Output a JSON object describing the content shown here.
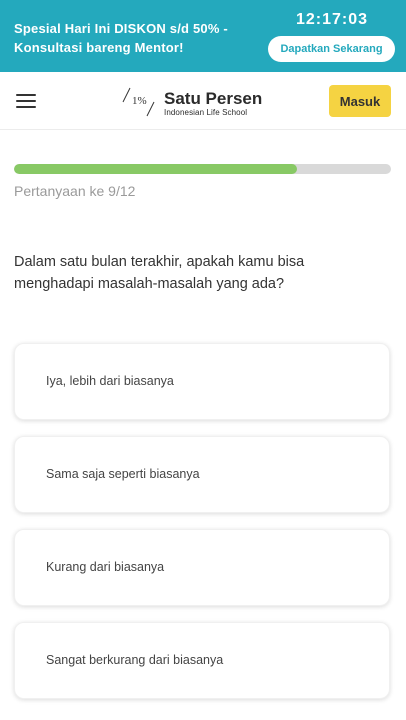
{
  "promo": {
    "text": "Spesial Hari Ini DISKON s/d 50% - Konsultasi bareng Mentor!",
    "timer": "12:17:03",
    "cta_label": "Dapatkan Sekarang"
  },
  "nav": {
    "menu_icon": "hamburger-menu-icon",
    "logo_mark": "1%",
    "logo_name": "Satu Persen",
    "logo_tagline": "Indonesian Life School",
    "login_label": "Masuk"
  },
  "progress": {
    "label": "Pertanyaan ke 9/12",
    "current": 9,
    "total": 12,
    "fill_color": "#88c965"
  },
  "question": {
    "text": "Dalam satu bulan terakhir, apakah kamu bisa menghadapi masalah-masalah yang ada?"
  },
  "options": [
    {
      "label": "Iya, lebih dari biasanya"
    },
    {
      "label": "Sama saja seperti biasanya"
    },
    {
      "label": "Kurang dari biasanya"
    },
    {
      "label": "Sangat berkurang dari biasanya"
    }
  ],
  "colors": {
    "brand_teal": "#24a9bd",
    "accent_yellow": "#f5d342",
    "progress_green": "#88c965"
  }
}
